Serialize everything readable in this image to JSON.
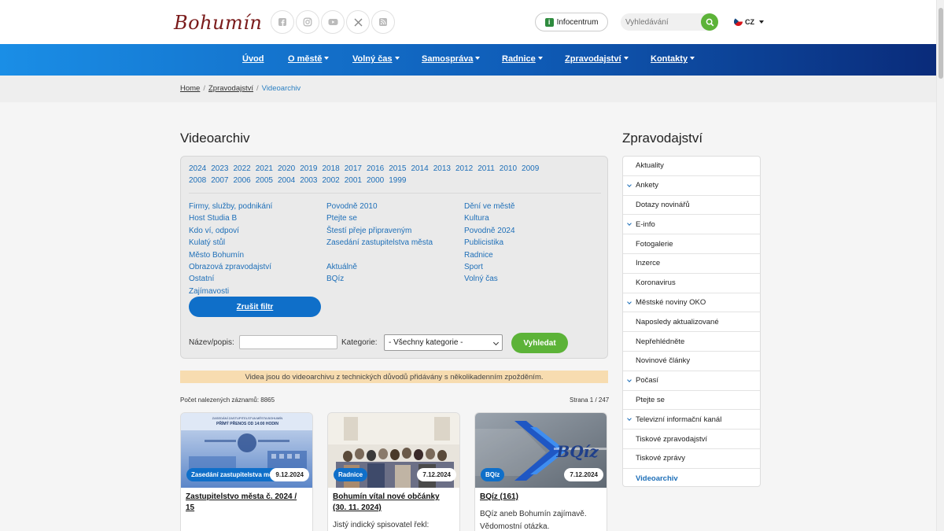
{
  "header": {
    "logo_text": "Bohumín",
    "social": [
      "facebook-icon",
      "instagram-icon",
      "youtube-icon",
      "x-icon",
      "rss-icon"
    ],
    "infocentrum_label": "Infocentrum",
    "search_placeholder": "Vyhledávání",
    "language": "CZ"
  },
  "nav": {
    "items": [
      {
        "label": "Úvod"
      },
      {
        "label": "O městě"
      },
      {
        "label": "Volný čas"
      },
      {
        "label": "Samospráva"
      },
      {
        "label": "Radnice"
      },
      {
        "label": "Zpravodajství"
      },
      {
        "label": "Kontakty"
      }
    ]
  },
  "breadcrumb": {
    "home": "Home",
    "section": "Zpravodajství",
    "current": "Videoarchiv",
    "separator": "/"
  },
  "main": {
    "title": "Videoarchiv",
    "years_row1": [
      "2024",
      "2023",
      "2022",
      "2021",
      "2020",
      "2019",
      "2018",
      "2017",
      "2016",
      "2015",
      "2014",
      "2013",
      "2012",
      "2011",
      "2010",
      "2009"
    ],
    "years_row2": [
      "2008",
      "2007",
      "2006",
      "2005",
      "2004",
      "2003",
      "2002",
      "2001",
      "2000",
      "1999"
    ],
    "categories_col1": [
      "Firmy, služby, podnikání",
      "Host Studia B",
      "Kdo ví, odpoví",
      "Kulatý stůl",
      "Město Bohumín",
      "Obrazová zpravodajství",
      "Ostatní",
      "Zajímavosti"
    ],
    "categories_col2": [
      "Povodně 2010",
      "Ptejte se",
      "Štestí přeje připraveným",
      "Zasedání zastupitelstva města",
      "",
      "Aktuálně",
      "BQíz"
    ],
    "categories_col3": [
      "Dění ve městě",
      "Kultura",
      "Povodně 2024",
      "Publicistika",
      "Radnice",
      "Sport",
      "Volný čas"
    ],
    "clear_filter_label": "Zrušit filtr",
    "name_label": "Název/popis:",
    "category_label": "Kategorie:",
    "category_selected": "- Všechny kategorie -",
    "search_button_label": "Vyhledat",
    "notice": "Videa jsou do videoarchivu z technických důvodů přidávány s několikadenním zpožděním.",
    "results_count": "Počet nalezených záznamů: 8865",
    "page_info": "Strana 1 / 247"
  },
  "cards": [
    {
      "tag": "Zasedání zastupitelstva města",
      "date": "9.12.2024",
      "title": "Zastupitelstvo města č. 2024 / 15",
      "text": "",
      "thumb_caption_1": "ZASEDÁNÍ ZASTUPITELSTVA MĚSTA BOHUMÍN",
      "thumb_caption_2": "PŘÍMÝ PŘENOS OD 14:00 HODIN"
    },
    {
      "tag": "Radnice",
      "date": "7.12.2024",
      "title": "Bohumín vítal nové občánky (30. 11. 2024)",
      "text": "Jistý indický spisovatel řekl: „Rodiče"
    },
    {
      "tag": "BQíz",
      "date": "7.12.2024",
      "title": "BQíz (161)",
      "text": "BQíz aneb Bohumín zajímavě. Vědomostní otázka.",
      "thumb_logo": "BQíz"
    }
  ],
  "sidebar": {
    "title": "Zpravodajství",
    "items": [
      {
        "label": "Aktuality",
        "expandable": false
      },
      {
        "label": "Ankety",
        "expandable": true
      },
      {
        "label": "Dotazy novinářů",
        "expandable": false
      },
      {
        "label": "E-info",
        "expandable": true
      },
      {
        "label": "Fotogalerie",
        "expandable": false
      },
      {
        "label": "Inzerce",
        "expandable": false
      },
      {
        "label": "Koronavirus",
        "expandable": false
      },
      {
        "label": "Městské noviny OKO",
        "expandable": true
      },
      {
        "label": "Naposledy aktualizované",
        "expandable": false
      },
      {
        "label": "Nepřehlédněte",
        "expandable": false
      },
      {
        "label": "Novinové články",
        "expandable": false
      },
      {
        "label": "Počasí",
        "expandable": true
      },
      {
        "label": "Ptejte se",
        "expandable": false
      },
      {
        "label": "Televizní informační kanál",
        "expandable": true
      },
      {
        "label": "Tiskové zpravodajství",
        "expandable": false
      },
      {
        "label": "Tiskové zprávy",
        "expandable": false
      },
      {
        "label": "Videoarchiv",
        "expandable": false,
        "active": true
      }
    ]
  },
  "colors": {
    "accent_blue": "#0f6fc9",
    "link_blue": "#1e6fb8",
    "green": "#5cb338",
    "notice_bg": "#f7dcb0"
  }
}
